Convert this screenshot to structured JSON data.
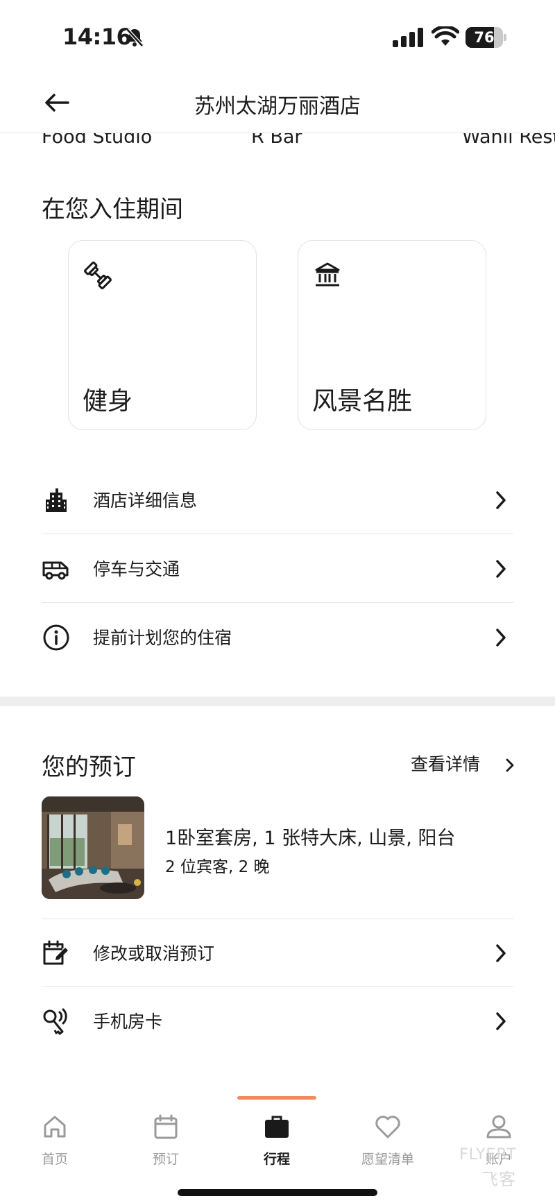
{
  "status_bar": {
    "time": "14:16",
    "battery": "76",
    "battery_level": 0.76
  },
  "header": {
    "title": "苏州太湖万丽酒店"
  },
  "restaurants": [
    "Food Studio",
    "R Bar",
    "Wanli Rest"
  ],
  "during_stay": {
    "title": "在您入住期间",
    "cards": [
      {
        "label": "健身",
        "icon": "dumbbell-icon"
      },
      {
        "label": "风景名胜",
        "icon": "landmark-icon"
      }
    ]
  },
  "info_rows": [
    {
      "label": "酒店详细信息",
      "icon": "building-icon"
    },
    {
      "label": "停车与交通",
      "icon": "van-icon"
    },
    {
      "label": "提前计划您的住宿",
      "icon": "info-icon"
    }
  ],
  "reservation": {
    "title": "您的预订",
    "view_details": "查看详情",
    "room_title": "1卧室套房, 1 张特大床, 山景, 阳台",
    "room_subtitle": "2 位宾客, 2 晚",
    "actions": [
      {
        "label": "修改或取消预订",
        "icon": "calendar-edit-icon"
      },
      {
        "label": "手机房卡",
        "icon": "mobile-key-icon"
      }
    ]
  },
  "tabs": [
    {
      "label": "首页",
      "icon": "home-icon"
    },
    {
      "label": "预订",
      "icon": "calendar-icon"
    },
    {
      "label": "行程",
      "icon": "briefcase-icon",
      "active": true
    },
    {
      "label": "愿望清单",
      "icon": "heart-icon"
    },
    {
      "label": "账户",
      "icon": "account-icon"
    }
  ],
  "watermark": {
    "text": "FLYERT",
    "sub": "飞客"
  },
  "colors": {
    "accent": "#f28b5c",
    "text": "#1c1c1c",
    "muted": "#9a9a9a",
    "divider": "#e6e6e6"
  }
}
